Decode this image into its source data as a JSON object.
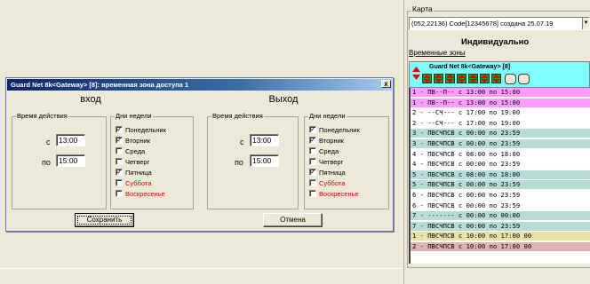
{
  "dialog": {
    "title": "Guard Net  8k<Gateway> [8]: временная зона доступа 1",
    "close": "x",
    "entry": {
      "title": "вход",
      "time_group": "Время действия",
      "from_label": "с",
      "from_value": "13:00",
      "to_label": "по",
      "to_value": "15:00",
      "days_group": "Дни недели",
      "days": [
        {
          "label": "Понедельник",
          "checked": true
        },
        {
          "label": "Вторник",
          "checked": true
        },
        {
          "label": "Среда",
          "checked": false
        },
        {
          "label": "Четверг",
          "checked": false
        },
        {
          "label": "Пятница",
          "checked": true
        },
        {
          "label": "Суббота",
          "checked": false,
          "color": "#e00000"
        },
        {
          "label": "Воскресенье",
          "checked": false,
          "color": "#e00000"
        }
      ]
    },
    "exit": {
      "title": "Выход",
      "time_group": "Время действия",
      "from_label": "с",
      "from_value": "13:00",
      "to_label": "по",
      "to_value": "15:00",
      "days_group": "Дни недели",
      "days": [
        {
          "label": "Понедельник",
          "checked": true
        },
        {
          "label": "Вторник",
          "checked": true
        },
        {
          "label": "Среда",
          "checked": false
        },
        {
          "label": "Четверг",
          "checked": false
        },
        {
          "label": "Пятница",
          "checked": true
        },
        {
          "label": "Суббота",
          "checked": false,
          "color": "#e00000"
        },
        {
          "label": "Воскресенье",
          "checked": false,
          "color": "#e00000"
        }
      ]
    },
    "save_label": "Сохранить",
    "cancel_label": "Отмена"
  },
  "panel": {
    "karta_label": "Карта",
    "combo_value": "(052,22136) Code[12345678] создана 25.07.19",
    "mode": "Индивидуально",
    "link": "Временные зоны",
    "table_title": "Guard Net  8k<Gateway> [8]",
    "rows": [
      {
        "text": "1 - ПВ--П-- с 13:00 по 15:00",
        "bg": "#ff9cff"
      },
      {
        "text": "1 - ПВ--П-- с 13:00 по 15:00",
        "bg": "#ff9cff"
      },
      {
        "text": "2 - --СЧ--- с 17:00 по 19:00",
        "bg": "#ffffff"
      },
      {
        "text": "2 - --СЧ--- с 17:00 по 19:00",
        "bg": "#ffffff"
      },
      {
        "text": "3 - ПВСЧПСВ с 00:00 по 23:59",
        "bg": "#b5ddd3"
      },
      {
        "text": "3 - ПВСЧПСВ с 00:00 по 23:59",
        "bg": "#b5ddd3"
      },
      {
        "text": "4 - ПВСЧПСВ с 08:00 по 18:00",
        "bg": "#ffffff"
      },
      {
        "text": "4 - ПВСЧПСВ с 00:00 по 23:59",
        "bg": "#ffffff"
      },
      {
        "text": "5 - ПВСЧПСВ с 08:00 по 18:00",
        "bg": "#b5ddd3"
      },
      {
        "text": "5 - ПВСЧПСВ с 00:00 по 23:59",
        "bg": "#b5ddd3"
      },
      {
        "text": "6 - ПВСЧПСВ с 00:00 по 23:59",
        "bg": "#ffffff"
      },
      {
        "text": "6 - ПВСЧПСВ с 00:00 по 23:59",
        "bg": "#ffffff"
      },
      {
        "text": "7 - ------- с 00:00 по 00:00",
        "bg": "#b5ddd3"
      },
      {
        "text": "7 - ПВСЧПСВ с 00:00 по 23:59",
        "bg": "#b5ddd3"
      },
      {
        "text": "1 - ПВСЧПСВ с 10:00 по 17:00 00",
        "bg": "#e9e2a8"
      },
      {
        "text": "2 - ПВСЧПСВ с 10:00 по 17:00 00",
        "bg": "#e2b2b2"
      }
    ]
  }
}
